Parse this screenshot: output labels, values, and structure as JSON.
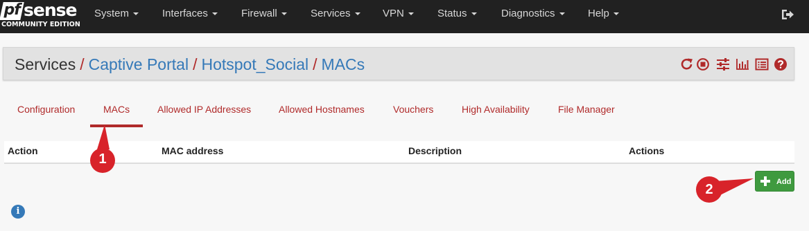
{
  "brand": {
    "logo_mark": "pf",
    "logo_name": "sense",
    "edition": "COMMUNITY EDITION"
  },
  "nav": {
    "items": [
      {
        "label": "System"
      },
      {
        "label": "Interfaces"
      },
      {
        "label": "Firewall"
      },
      {
        "label": "Services"
      },
      {
        "label": "VPN"
      },
      {
        "label": "Status"
      },
      {
        "label": "Diagnostics"
      },
      {
        "label": "Help"
      }
    ],
    "logout_icon": "sign-out-icon"
  },
  "breadcrumb": {
    "root": "Services",
    "separator": "/",
    "links": [
      "Captive Portal",
      "Hotspot_Social",
      "MACs"
    ]
  },
  "header_icons": [
    "reload-icon",
    "stop-circle-icon",
    "sliders-icon",
    "bar-chart-icon",
    "list-icon",
    "question-circle-icon"
  ],
  "tabs": {
    "items": [
      {
        "label": "Configuration"
      },
      {
        "label": "MACs",
        "active": true
      },
      {
        "label": "Allowed IP Addresses"
      },
      {
        "label": "Allowed Hostnames"
      },
      {
        "label": "Vouchers"
      },
      {
        "label": "High Availability"
      },
      {
        "label": "File Manager"
      }
    ]
  },
  "table": {
    "columns": [
      "Action",
      "MAC address",
      "Description",
      "Actions"
    ],
    "rows": []
  },
  "add_button": {
    "label": "Add",
    "icon": "plus-icon"
  },
  "info_icon": "info-circle-icon",
  "annotations": [
    {
      "number": "1"
    },
    {
      "number": "2"
    }
  ],
  "colors": {
    "navbar": "#212121",
    "accent_red": "#b02a2a",
    "link_blue": "#3579b8",
    "add_green": "#3f9a3f",
    "annotation_red": "#d8232a"
  }
}
